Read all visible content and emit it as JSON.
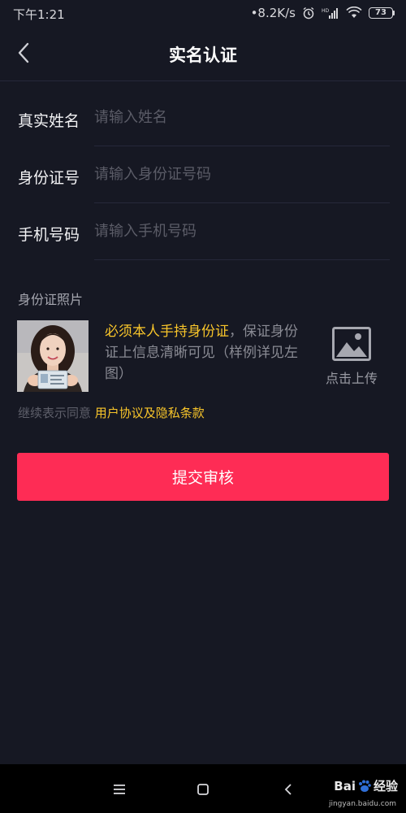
{
  "status_bar": {
    "time": "下午1:21",
    "network_speed": "•8.2K/s",
    "battery": "73"
  },
  "header": {
    "title": "实名认证"
  },
  "form": {
    "name": {
      "label": "真实姓名",
      "placeholder": "请输入姓名"
    },
    "id_number": {
      "label": "身份证号",
      "placeholder": "请输入身份证号码"
    },
    "phone": {
      "label": "手机号码",
      "placeholder": "请输入手机号码"
    }
  },
  "id_photo": {
    "section_title": "身份证照片",
    "desc_highlight": "必须本人手持身份证",
    "desc_rest": "，保证身份证上信息清晰可见（样例详见左图）",
    "upload_label": "点击上传"
  },
  "agreement": {
    "prefix": "继续表示同意",
    "link": "用户协议及隐私条款"
  },
  "submit_label": "提交审核",
  "watermark": {
    "brand": "Bai",
    "brand_suffix": "经验",
    "url": "jingyan.baidu.com"
  },
  "colors": {
    "background": "#161823",
    "accent": "#fe2c55",
    "highlight": "#f8c52a"
  }
}
